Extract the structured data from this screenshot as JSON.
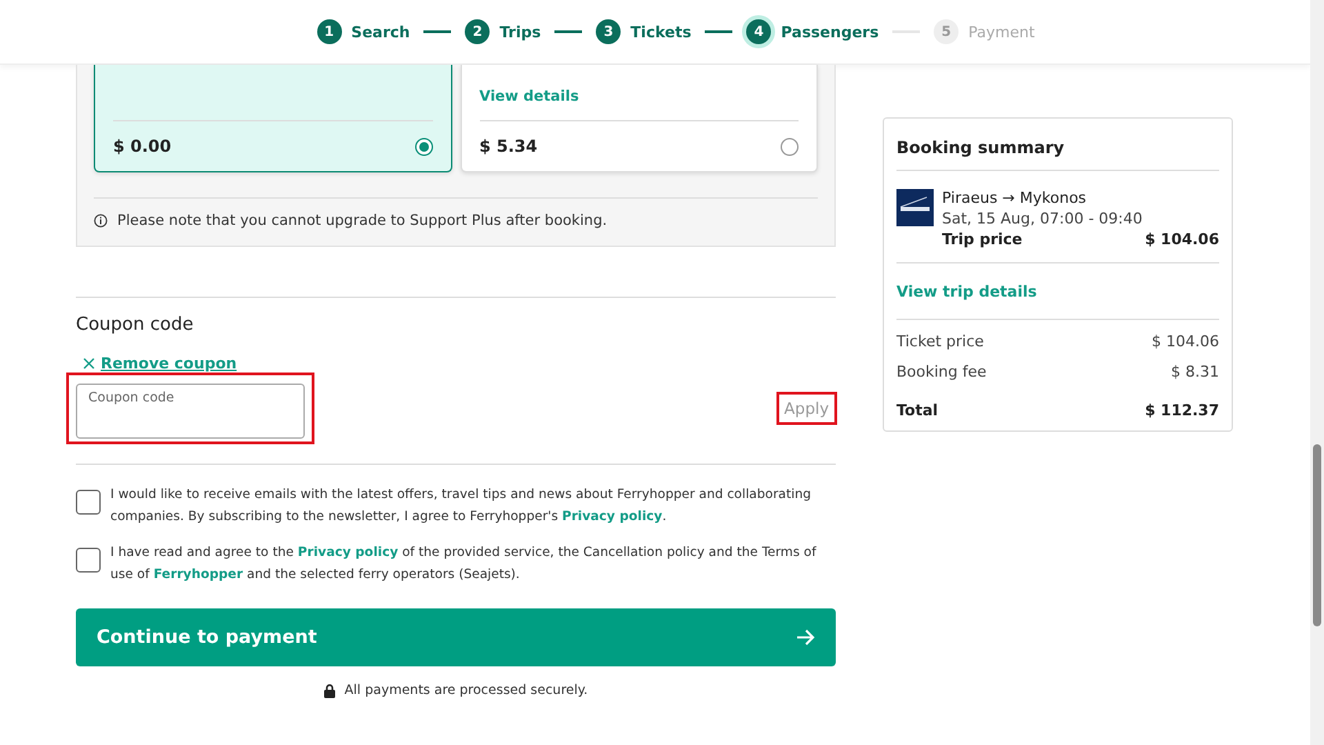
{
  "stepper": [
    {
      "number": "1",
      "label": "Search",
      "completed": true,
      "selected": false
    },
    {
      "number": "2",
      "label": "Trips",
      "completed": true,
      "selected": false
    },
    {
      "number": "3",
      "label": "Tickets",
      "completed": true,
      "selected": false
    },
    {
      "number": "4",
      "label": "Passengers",
      "completed": false,
      "selected": true
    },
    {
      "number": "5",
      "label": "Payment",
      "completed": false,
      "selected": false
    }
  ],
  "support_options": [
    {
      "price": "$ 0.00",
      "selected": true
    },
    {
      "link": "View details",
      "price": "$ 5.34",
      "selected": false
    }
  ],
  "support_note": "Please note that you cannot upgrade to Support Plus after booking.",
  "coupon": {
    "title": "Coupon code",
    "remove_link": "Remove coupon",
    "field": {
      "placeholder": "Coupon code",
      "highlighted": true
    },
    "apply": {
      "label": "Apply",
      "highlighted": true
    }
  },
  "consents": [
    {
      "checked": false,
      "parts": [
        {
          "text": "I would like to receive emails with the latest offers, travel tips and news about Ferryhopper and collaborating companies. By subscribing to the newsletter, I agree to Ferryhopper's ",
          "link": false
        },
        {
          "text": "Privacy policy",
          "link": true
        },
        {
          "text": ".",
          "link": false
        }
      ]
    },
    {
      "checked": false,
      "parts": [
        {
          "text": "I have read and agree to the ",
          "link": false
        },
        {
          "text": "Privacy policy",
          "link": true
        },
        {
          "text": " of the provided service, the Cancellation policy and the Terms of use of ",
          "link": false
        },
        {
          "text": "Ferryhopper",
          "link": true
        },
        {
          "text": " and the selected ferry operators (Seajets).",
          "link": false
        }
      ]
    }
  ],
  "continue_button": "Continue to payment",
  "secure_note": "All payments are processed securely.",
  "summary": {
    "title": "Booking summary",
    "route_from": "Piraeus",
    "route_arrow": "→",
    "route_to": "Mykonos",
    "date": "Sat, 15 Aug, 07:00 - 09:40",
    "trip_price_label": "Trip price",
    "trip_price": "$ 104.06",
    "details_link": "View trip details",
    "lines": [
      {
        "label": "Ticket price",
        "value": "$ 104.06",
        "kind": "regular"
      },
      {
        "label": "Booking fee",
        "value": "$ 8.31",
        "kind": "regular"
      },
      {
        "label": "Total",
        "value": "$ 112.37",
        "kind": "total"
      }
    ]
  }
}
